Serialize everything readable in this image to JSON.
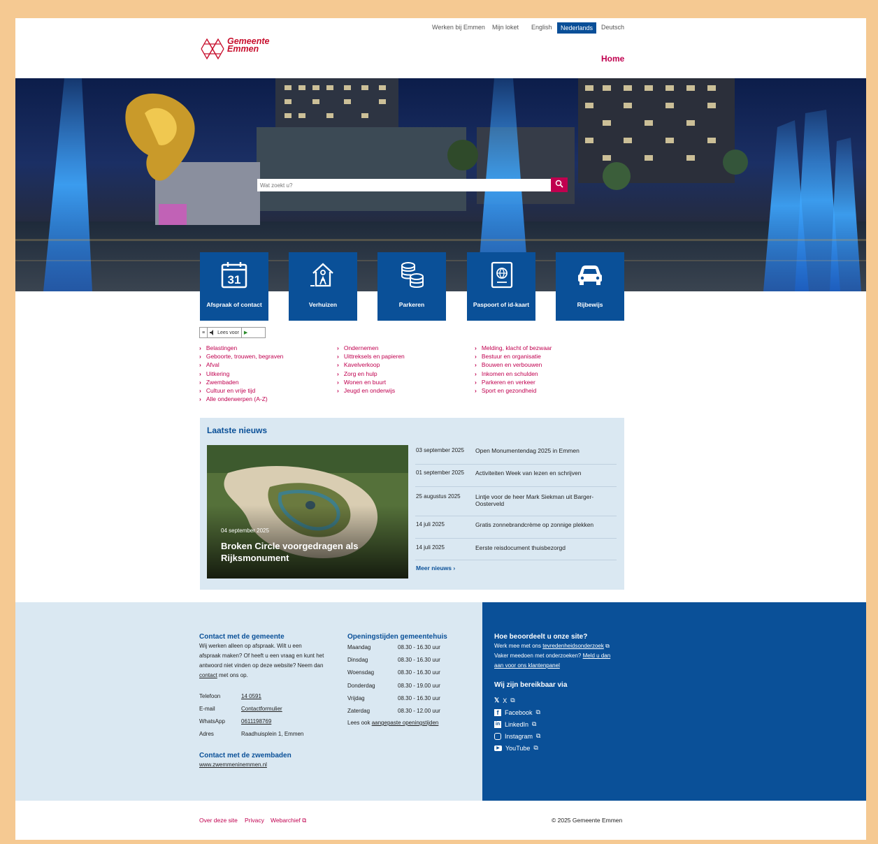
{
  "topbar": {
    "links": [
      "Werken bij Emmen",
      "Mijn loket"
    ],
    "languages": [
      "English",
      "Nederlands",
      "Deutsch"
    ],
    "active_language": "Nederlands"
  },
  "logo": {
    "line1": "Gemeente",
    "line2": "Emmen"
  },
  "nav": {
    "home": "Home"
  },
  "search": {
    "placeholder": "Wat zoekt u?"
  },
  "tiles": [
    {
      "label": "Afspraak of contact",
      "icon": "calendar-icon",
      "number": "31"
    },
    {
      "label": "Verhuizen",
      "icon": "house-move-icon"
    },
    {
      "label": "Parkeren",
      "icon": "coins-icon"
    },
    {
      "label": "Paspoort of id-kaart",
      "icon": "passport-icon"
    },
    {
      "label": "Rijbewijs",
      "icon": "car-icon"
    }
  ],
  "reader": {
    "label": "Lees voor"
  },
  "topics": {
    "col1": [
      "Belastingen",
      "Geboorte, trouwen, begraven",
      "Afval",
      "Uitkering",
      "Zwembaden",
      "Cultuur en vrije tijd",
      "Alle onderwerpen (A-Z)"
    ],
    "col2": [
      "Ondernemen",
      "Uittreksels en papieren",
      "Kavelverkoop",
      "Zorg en hulp",
      "Wonen en buurt",
      "Jeugd en onderwijs"
    ],
    "col3": [
      "Melding, klacht of bezwaar",
      "Bestuur en organisatie",
      "Bouwen en verbouwen",
      "Inkomen en schulden",
      "Parkeren en verkeer",
      "Sport en gezondheid"
    ]
  },
  "news": {
    "title": "Laatste nieuws",
    "featured": {
      "date": "04 september 2025",
      "headline": "Broken Circle voorgedragen als Rijksmonument"
    },
    "items": [
      {
        "date": "03 september 2025",
        "text": "Open Monumentendag 2025 in Emmen"
      },
      {
        "date": "01 september 2025",
        "text": "Activiteiten Week van lezen en schrijven"
      },
      {
        "date": "25 augustus 2025",
        "text": "Lintje voor de heer Mark Siekman uit Barger-Oosterveld"
      },
      {
        "date": "14 juli 2025",
        "text": "Gratis zonnebrandcrème op zonnige plekken"
      },
      {
        "date": "14 juli 2025",
        "text": "Eerste reisdocument thuisbezorgd"
      }
    ],
    "more": "Meer nieuws"
  },
  "contact": {
    "title": "Contact met de gemeente",
    "intro_lines": [
      "Wij werken alleen op afspraak. Wilt u een",
      "afspraak maken? Of heeft u een vraag en kunt het",
      "antwoord niet vinden op deze website? Neem dan"
    ],
    "intro_link": "contact",
    "intro_end": " met ons op.",
    "rows": [
      {
        "label": "Telefoon",
        "value": "14 0591"
      },
      {
        "label": "E-mail",
        "value": "Contactformulier"
      },
      {
        "label": "WhatsApp",
        "value": "0611198769"
      },
      {
        "label": "Adres",
        "value": "Raadhuisplein 1, Emmen"
      }
    ],
    "pool_title": "Contact met de zwembaden",
    "pool_link": "www.zwemmeninemmen.nl"
  },
  "hours": {
    "title": "Openingstijden gemeentehuis",
    "rows": [
      {
        "day": "Maandag",
        "time": "08.30 - 16.30 uur"
      },
      {
        "day": "Dinsdag",
        "time": "08.30 - 16.30 uur"
      },
      {
        "day": "Woensdag",
        "time": "08.30 - 16.30 uur"
      },
      {
        "day": "Donderdag",
        "time": "08.30 - 19.00 uur"
      },
      {
        "day": "Vrijdag",
        "time": "08.30 - 16.30 uur"
      },
      {
        "day": "Zaterdag",
        "time": "08.30 - 12.00 uur"
      }
    ],
    "note_prefix": "Lees ook ",
    "note_link": "aangepaste openingstijden"
  },
  "rate": {
    "title": "Hoe beoordeelt u onze site?",
    "line1_prefix": "Werk mee met ons ",
    "line1_link": "tevredenheidsonderzoek",
    "line2_prefix": "Vaker meedoen met onderzoeken? ",
    "line2_link_a": "Meld u dan",
    "line2_link_b": "aan voor ons klantenpanel",
    "reach_title": "Wij zijn bereikbaar via",
    "socials": [
      "X",
      "Facebook",
      "LinkedIn",
      "Instagram",
      "YouTube"
    ]
  },
  "bottom": {
    "links": [
      "Over deze site",
      "Privacy",
      "Webarchief"
    ],
    "copyright": "© 2025 Gemeente Emmen"
  },
  "colors": {
    "brand_blue": "#0a5098",
    "accent": "#c0004f",
    "frame": "#f5c992"
  }
}
